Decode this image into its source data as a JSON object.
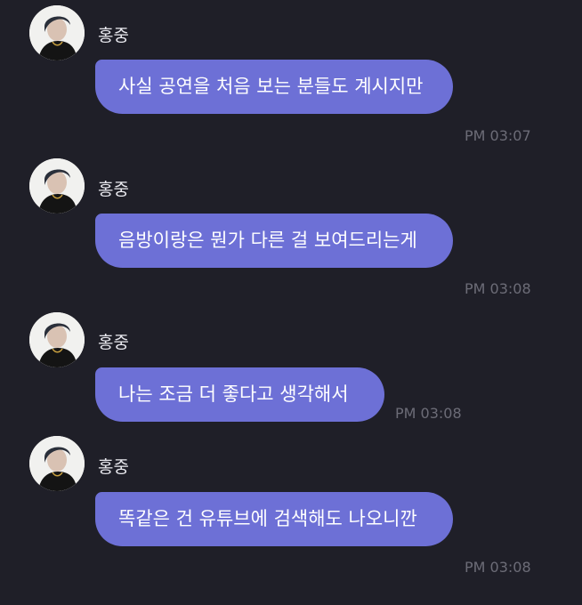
{
  "colors": {
    "background": "#1f1f28",
    "bubble": "#6d70d6",
    "bubble_text": "#ffffff",
    "sender_text": "#e8e8ee",
    "time_text": "#6c6c77"
  },
  "messages": [
    {
      "sender": "홍중",
      "avatar_icon": "profile-photo-icon",
      "text": "사실 공연을 처음 보는 분들도 계시지만",
      "time": "PM 03:07"
    },
    {
      "sender": "홍중",
      "avatar_icon": "profile-photo-icon",
      "text": "음방이랑은 뭔가 다른 걸 보여드리는게",
      "time": "PM 03:08"
    },
    {
      "sender": "홍중",
      "avatar_icon": "profile-photo-icon",
      "text": "나는 조금 더 좋다고 생각해서",
      "time": "PM 03:08"
    },
    {
      "sender": "홍중",
      "avatar_icon": "profile-photo-icon",
      "text": "똑같은 건 유튜브에 검색해도 나오니깐",
      "time": "PM 03:08"
    }
  ]
}
